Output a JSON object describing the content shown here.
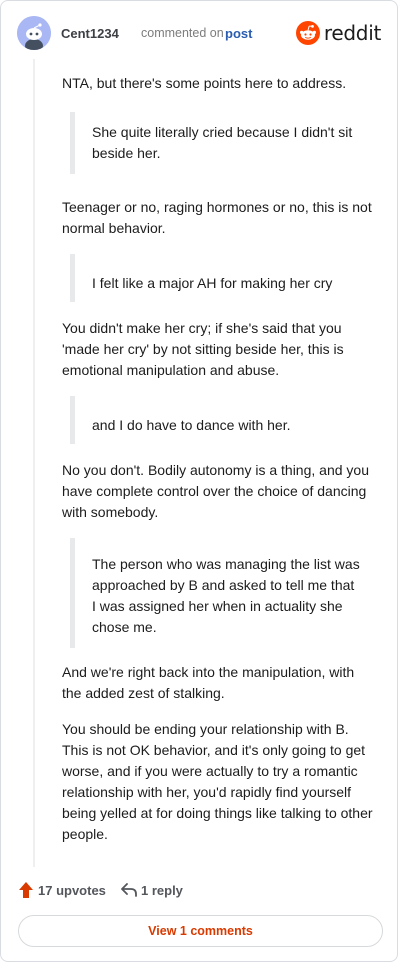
{
  "header": {
    "username": "Cent1234",
    "action_text": "commented on",
    "post_link": "post",
    "brand_wordmark": "reddit",
    "brand_color": "#ff4500"
  },
  "comment": {
    "blocks": [
      {
        "type": "paragraph",
        "text": "NTA, but there's some points here to address."
      },
      {
        "type": "quote",
        "text": "She quite literally cried because I didn't sit beside her."
      },
      {
        "type": "paragraph",
        "text": "Teenager or no, raging hormones or no, this is not normal behavior."
      },
      {
        "type": "quote",
        "text": "I felt like a major AH for making her cry"
      },
      {
        "type": "paragraph",
        "text": "You didn't make her cry; if she's said that you 'made her cry' by not sitting beside her, this is emotional manipulation and abuse."
      },
      {
        "type": "quote",
        "text": "and I do have to dance with her."
      },
      {
        "type": "paragraph",
        "text": "No you don't. Bodily autonomy is a thing, and you have complete control over the choice of dancing with somebody."
      },
      {
        "type": "quote",
        "text": "The person who was managing the list was approached by B and asked to tell me that I was assigned her when in actuality she chose me."
      },
      {
        "type": "paragraph",
        "text": "And we're right back into the manipulation, with the added zest of stalking."
      },
      {
        "type": "paragraph",
        "text": "You should be ending your relationship with B. This is not OK behavior, and it's only going to get worse, and if you were actually to try a romantic relationship with her, you'd rapidly find yourself being yelled at for doing things like talking to other people."
      }
    ]
  },
  "footer": {
    "upvotes_label": "17 upvotes",
    "reply_label": "1 reply",
    "view_comments_label": "View 1 comments",
    "upvote_color": "#d93a00"
  },
  "icons": {
    "avatar": "snoo-avatar-icon",
    "brand": "reddit-logo-icon",
    "upvote": "upvote-arrow-icon",
    "reply": "reply-arrow-icon"
  }
}
